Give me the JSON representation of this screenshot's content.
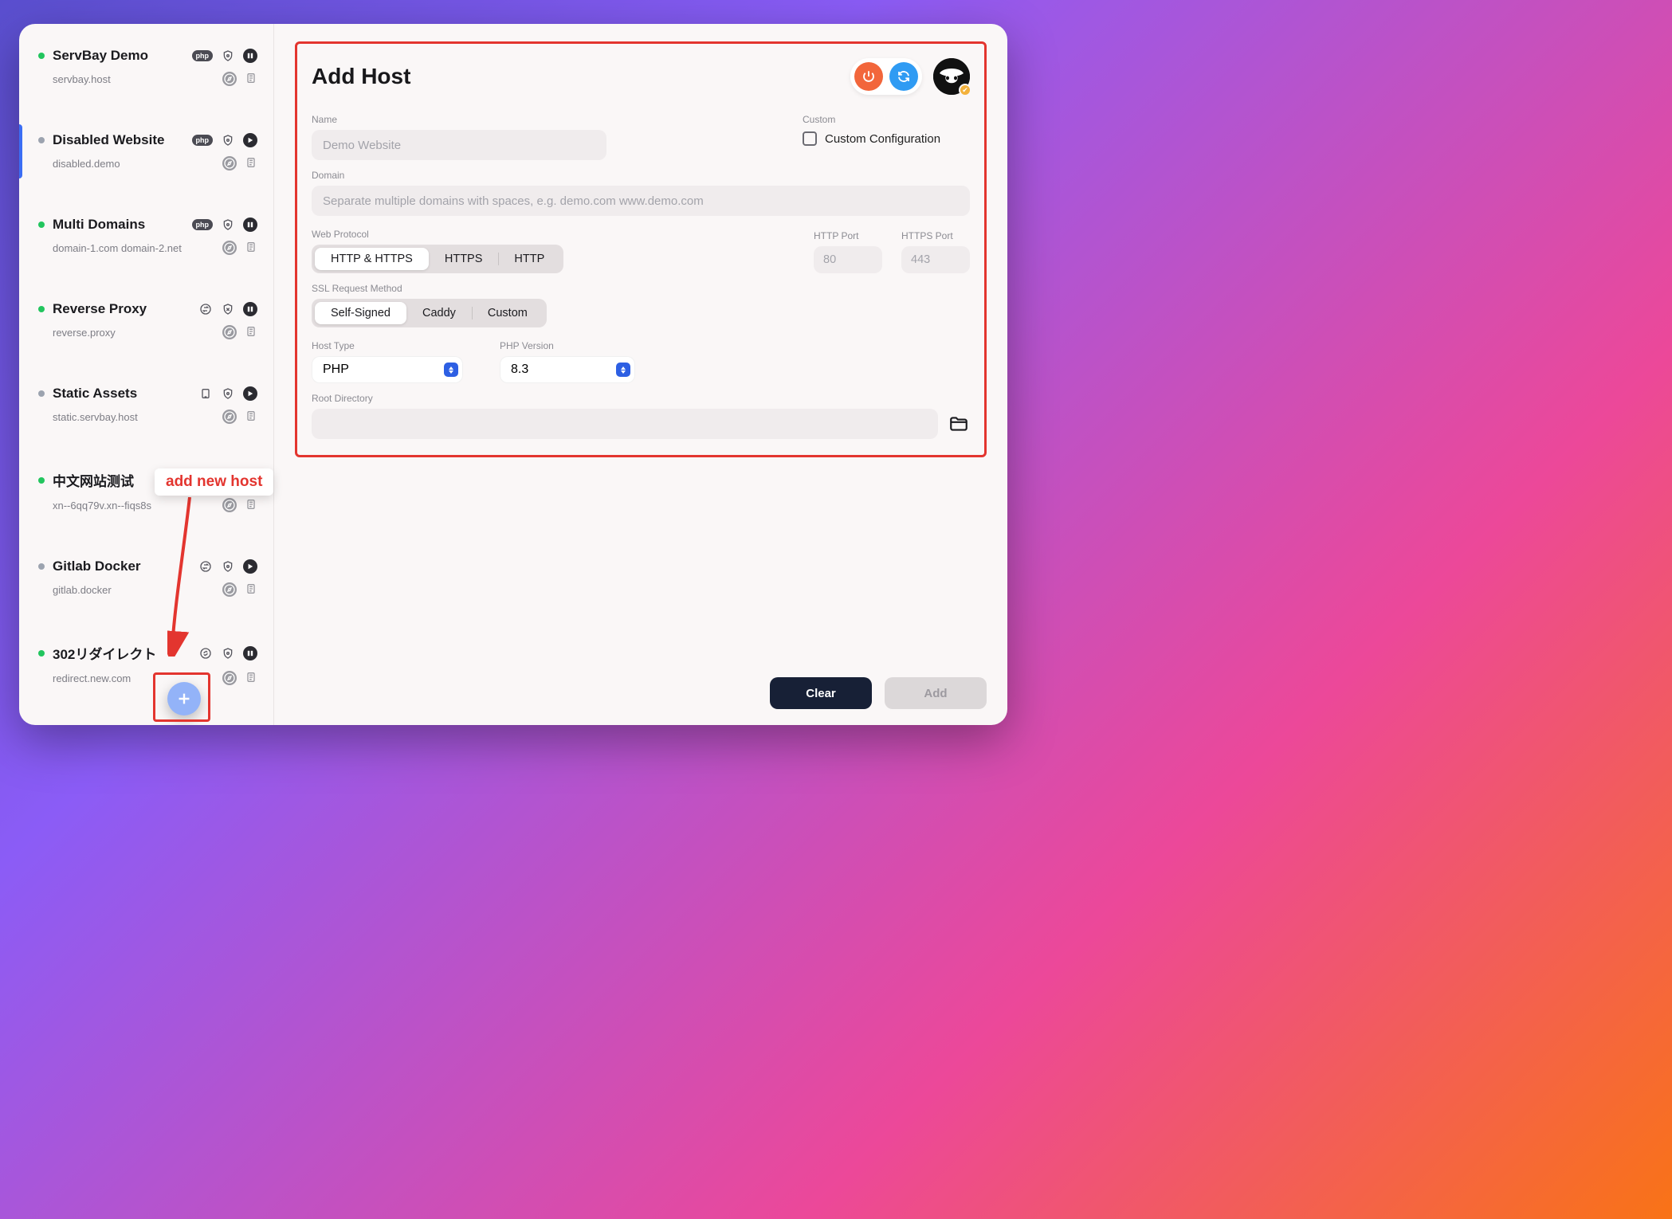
{
  "sidebar": {
    "items": [
      {
        "status": "green",
        "title": "ServBay Demo",
        "domain": "servbay.host",
        "icon_a": "php",
        "icon_b": "shield-lock",
        "icon_c": "pause",
        "sub_a": "compass",
        "sub_b": "note",
        "selected": false
      },
      {
        "status": "grey",
        "title": "Disabled Website",
        "domain": "disabled.demo",
        "icon_a": "php",
        "icon_b": "shield-lock",
        "icon_c": "play",
        "sub_a": "compass",
        "sub_b": "note",
        "selected": true
      },
      {
        "status": "green",
        "title": "Multi Domains",
        "domain": "domain-1.com domain-2.net",
        "icon_a": "php",
        "icon_b": "shield-lock",
        "icon_c": "pause",
        "sub_a": "compass",
        "sub_b": "note",
        "selected": false
      },
      {
        "status": "green",
        "title": "Reverse Proxy",
        "domain": "reverse.proxy",
        "icon_a": "swap",
        "icon_b": "shield-x",
        "icon_c": "pause",
        "sub_a": "compass",
        "sub_b": "note",
        "selected": false
      },
      {
        "status": "grey",
        "title": "Static Assets",
        "domain": "static.servbay.host",
        "icon_a": "device",
        "icon_b": "shield-lock",
        "icon_c": "play",
        "sub_a": "compass",
        "sub_b": "note",
        "selected": false
      },
      {
        "status": "green",
        "title": "中文网站测试",
        "domain": "xn--6qq79v.xn--fiqs8s",
        "icon_a": "php",
        "icon_b": "shield-lock",
        "icon_c": "pause",
        "sub_a": "compass",
        "sub_b": "note",
        "selected": false
      },
      {
        "status": "grey",
        "title": "Gitlab Docker",
        "domain": "gitlab.docker",
        "icon_a": "swap",
        "icon_b": "shield-lock",
        "icon_c": "play",
        "sub_a": "compass",
        "sub_b": "note",
        "selected": false
      },
      {
        "status": "green",
        "title": "302リダイレクト",
        "domain": "redirect.new.com",
        "icon_a": "redirect",
        "icon_b": "shield-lock",
        "icon_c": "pause",
        "sub_a": "compass",
        "sub_b": "note",
        "selected": false
      }
    ]
  },
  "callout": "add new host",
  "main": {
    "title": "Add Host",
    "labels": {
      "name": "Name",
      "domain": "Domain",
      "custom": "Custom",
      "custom_config": "Custom Configuration",
      "web_protocol": "Web Protocol",
      "http_port": "HTTP Port",
      "https_port": "HTTPS Port",
      "ssl_method": "SSL Request Method",
      "host_type": "Host Type",
      "php_version": "PHP Version",
      "root_dir": "Root Directory"
    },
    "placeholders": {
      "name": "Demo Website",
      "domain": "Separate multiple domains with spaces, e.g. demo.com www.demo.com",
      "http_port": "80",
      "https_port": "443"
    },
    "protocol_options": [
      "HTTP & HTTPS",
      "HTTPS",
      "HTTP"
    ],
    "protocol_active": 0,
    "ssl_options": [
      "Self-Signed",
      "Caddy",
      "Custom"
    ],
    "ssl_active": 0,
    "host_type_value": "PHP",
    "php_version_value": "8.3"
  },
  "footer": {
    "clear": "Clear",
    "add": "Add"
  }
}
